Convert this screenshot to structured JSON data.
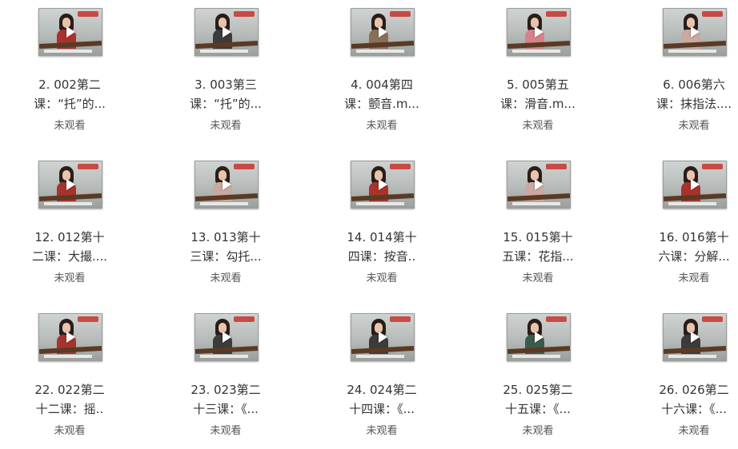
{
  "status_text": "未观看",
  "items": [
    {
      "title": "2. 002第二\n课：“托”的...",
      "status": "未观看",
      "thumb_style": "red"
    },
    {
      "title": "3. 003第三\n课：“托”的...",
      "status": "未观看",
      "thumb_style": "dark"
    },
    {
      "title": "4. 004第四\n课：颤音.m...",
      "status": "未观看",
      "thumb_style": "pattern"
    },
    {
      "title": "5. 005第五\n课：滑音.m...",
      "status": "未观看",
      "thumb_style": "pink"
    },
    {
      "title": "6. 006第六\n课：抹指法....",
      "status": "未观看",
      "thumb_style": "light"
    },
    {
      "title": "12. 012第十\n二课：大撮....",
      "status": "未观看",
      "thumb_style": "red"
    },
    {
      "title": "13. 013第十\n三课：勾托...",
      "status": "未观看",
      "thumb_style": "light"
    },
    {
      "title": "14. 014第十\n四课：按音..",
      "status": "未观看",
      "thumb_style": "red"
    },
    {
      "title": "15. 015第十\n五课：花指...",
      "status": "未观看",
      "thumb_style": "light"
    },
    {
      "title": "16. 016第十\n六课：分解...",
      "status": "未观看",
      "thumb_style": "red"
    },
    {
      "title": "22. 022第二\n十二课：摇..",
      "status": "未观看",
      "thumb_style": "red"
    },
    {
      "title": "23. 023第二\n十三课：《...",
      "status": "未观看",
      "thumb_style": "dark"
    },
    {
      "title": "24. 024第二\n十四课：《...",
      "status": "未观看",
      "thumb_style": "dark"
    },
    {
      "title": "25. 025第二\n十五课：《...",
      "status": "未观看",
      "thumb_style": "green"
    },
    {
      "title": "26. 026第二\n十六课：《...",
      "status": "未观看",
      "thumb_style": "dark"
    }
  ]
}
